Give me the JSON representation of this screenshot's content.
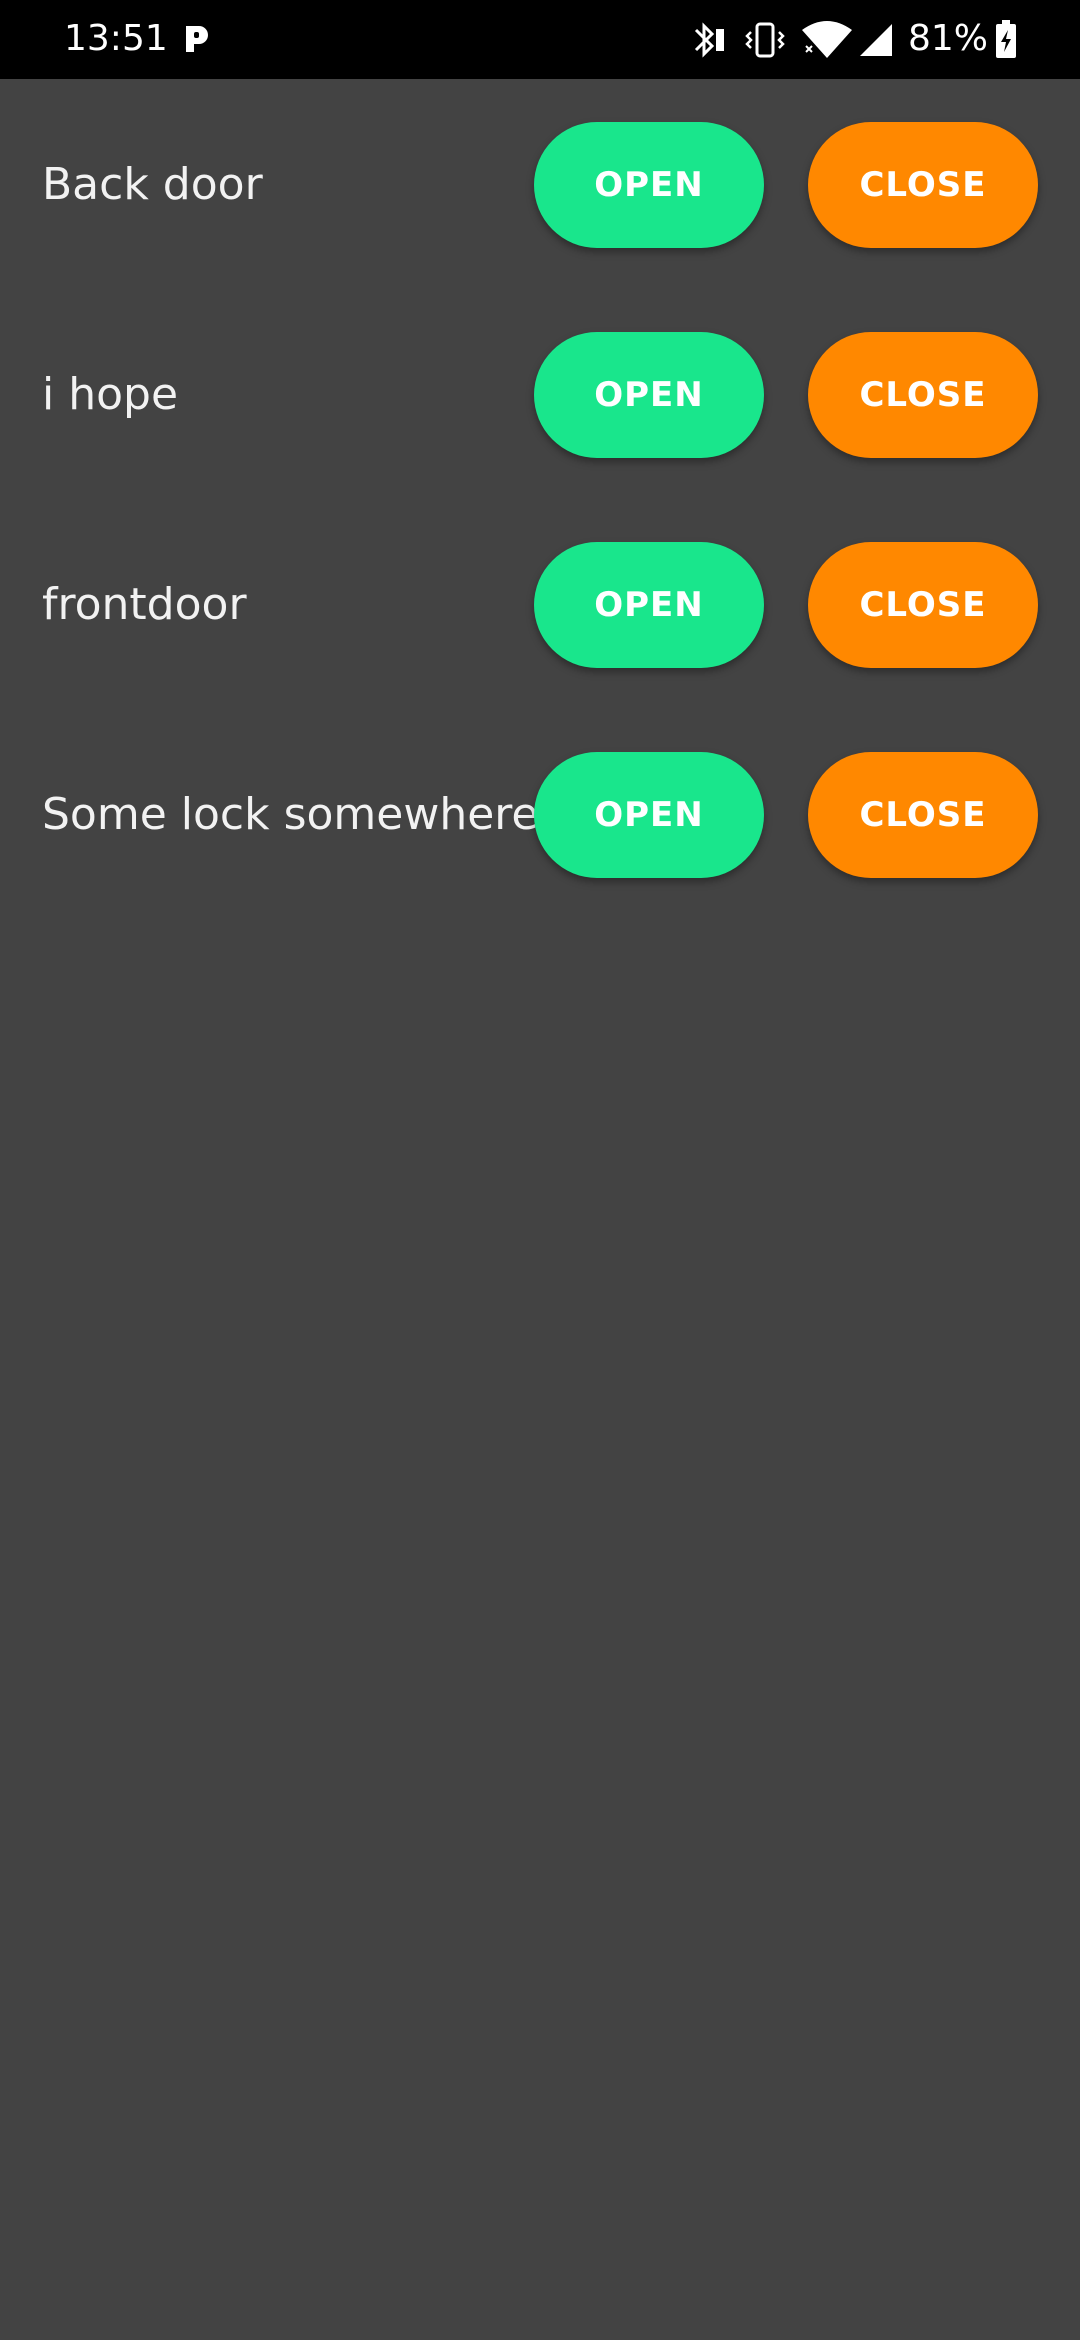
{
  "status_bar": {
    "time": "13:51",
    "battery_percent": "81%",
    "icons": [
      "parking-app-icon",
      "bluetooth-icon",
      "vibrate-icon",
      "wifi-icon",
      "cell-signal-icon",
      "battery-charging-icon"
    ]
  },
  "colors": {
    "background": "#434343",
    "open_button": "#19e68c",
    "close_button": "#ff8800",
    "text": "#f2f2f2"
  },
  "locks": [
    {
      "name": "Back door",
      "open_label": "OPEN",
      "close_label": "CLOSE"
    },
    {
      "name": "i hope",
      "open_label": "OPEN",
      "close_label": "CLOSE"
    },
    {
      "name": "frontdoor",
      "open_label": "OPEN",
      "close_label": "CLOSE"
    },
    {
      "name": "Some lock somewhere",
      "open_label": "OPEN",
      "close_label": "CLOSE"
    }
  ]
}
